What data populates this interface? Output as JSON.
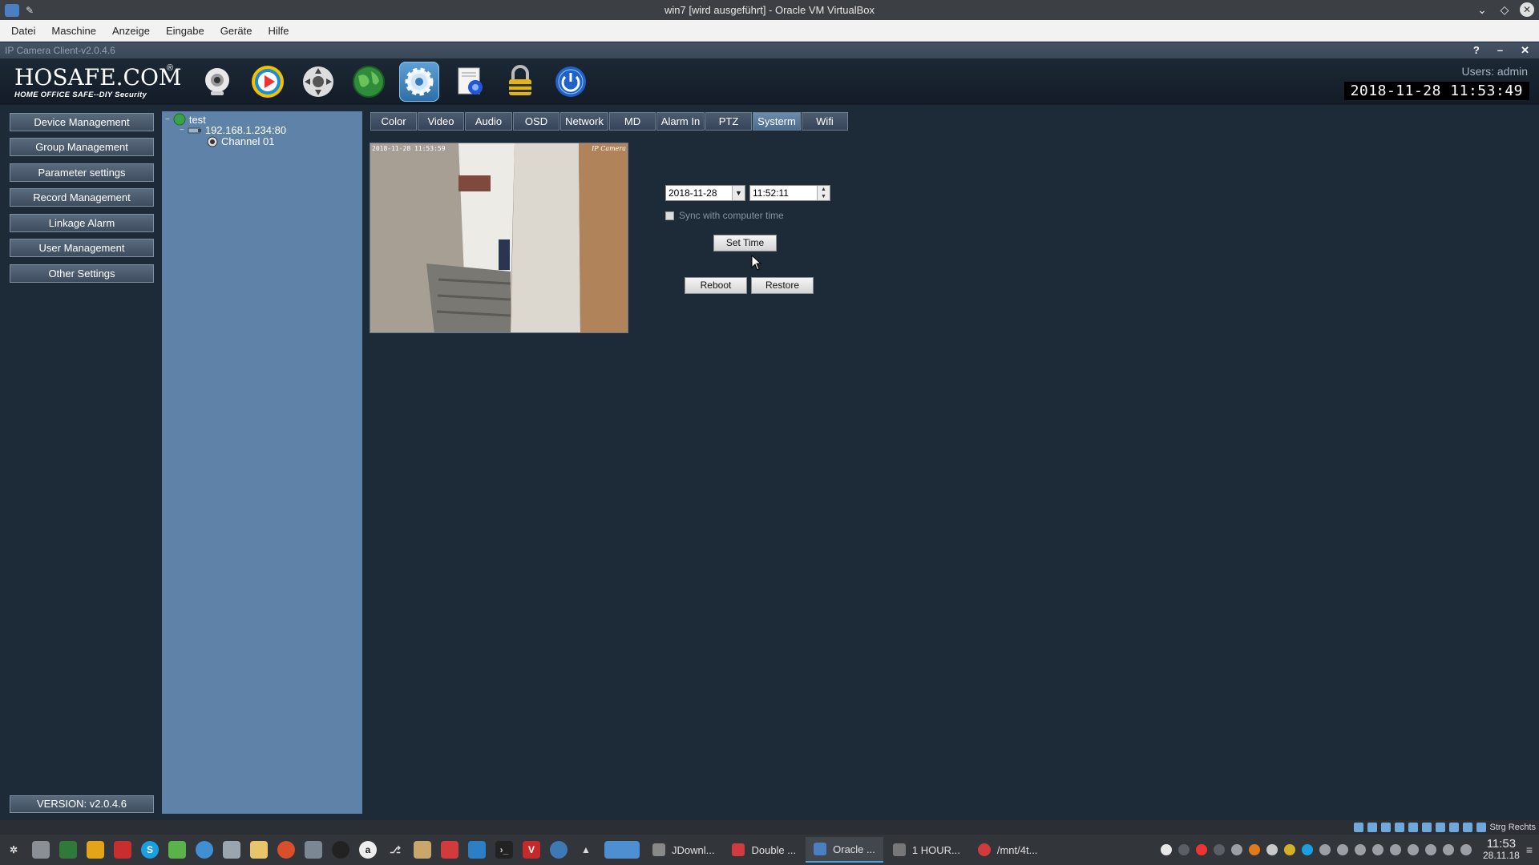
{
  "host": {
    "window_title": "win7 [wird ausgeführt] - Oracle VM VirtualBox",
    "menu": [
      "Datei",
      "Maschine",
      "Anzeige",
      "Eingabe",
      "Geräte",
      "Hilfe"
    ]
  },
  "app": {
    "title": "IP Camera Client-v2.0.4.6",
    "title_controls": [
      "?",
      "–",
      "✕"
    ],
    "brand": "HOSAFE.COM",
    "brand_reg": "®",
    "tagline": "HOME OFFICE SAFE--DIY Security",
    "toolbar": [
      {
        "name": "live-view-camera-icon"
      },
      {
        "name": "playback-icon"
      },
      {
        "name": "ptz-control-icon"
      },
      {
        "name": "network-globe-icon"
      },
      {
        "name": "settings-gear-icon",
        "active": true
      },
      {
        "name": "record-icon"
      },
      {
        "name": "lock-icon"
      },
      {
        "name": "power-icon"
      }
    ],
    "users_label": "Users: admin",
    "datetime": "2018-11-28  11:53:49"
  },
  "nav": {
    "items": [
      "Device Management",
      "Group Management",
      "Parameter settings",
      "Record Management",
      "Linkage Alarm",
      "User Management",
      "Other Settings"
    ],
    "version": "VERSION: v2.0.4.6"
  },
  "tree": {
    "group": "test",
    "device": "192.168.1.234:80",
    "channel": "Channel 01"
  },
  "tabs": [
    "Color",
    "Video",
    "Audio",
    "OSD",
    "Network",
    "MD",
    "Alarm In",
    "PTZ",
    "Systerm",
    "Wifi"
  ],
  "active_tab": "Systerm",
  "preview": {
    "stamp_left": "2018-11-28 11:53:59",
    "stamp_right": "IP Camera"
  },
  "system": {
    "date_value": "2018-11-28",
    "time_value": "11:52:11",
    "sync_label": "Sync with computer time",
    "sync_checked": false,
    "set_time_label": "Set Time",
    "reboot_label": "Reboot",
    "restore_label": "Restore"
  },
  "taskbar": {
    "tasks": [
      "JDownl...",
      "Double ...",
      "Oracle ...",
      "1 HOUR...",
      "/mnt/4t..."
    ],
    "active_task": "Oracle ...",
    "keyboard_hint": "Strg Rechts",
    "time": "11:53",
    "date": "28.11.18"
  }
}
